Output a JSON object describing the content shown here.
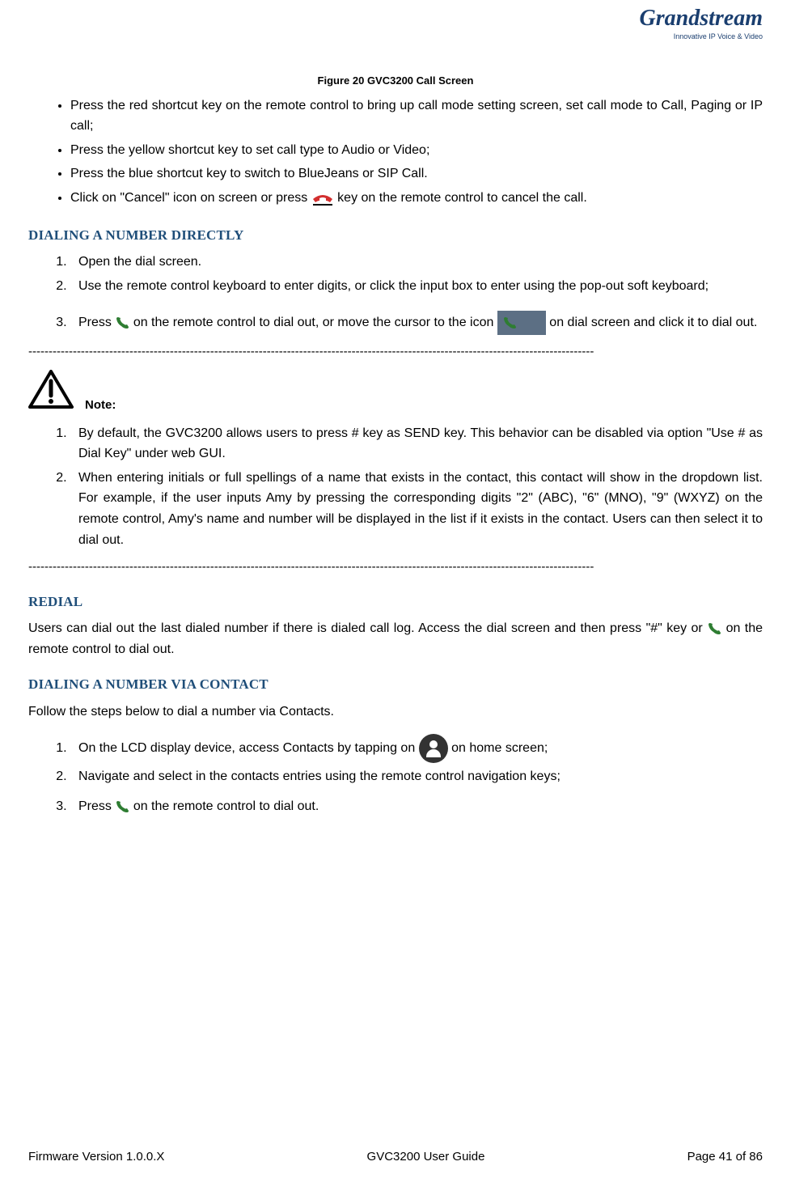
{
  "logo": {
    "brand": "Grandstream",
    "tagline": "Innovative IP Voice & Video"
  },
  "figure_caption": "Figure 20 GVC3200 Call Screen",
  "bullets": [
    "Press the red shortcut key on the remote control to bring up call mode setting screen, set call mode to Call, Paging or IP call;",
    "Press the yellow shortcut key to set call type to Audio or Video;",
    "Press the blue shortcut key to switch to BlueJeans or SIP Call."
  ],
  "bullet4_a": "Click on \"Cancel\" icon on screen or press",
  "bullet4_b": "key on the remote control to cancel the call.",
  "h_dial_direct": "DIALING A NUMBER DIRECTLY",
  "dd_steps": {
    "1": "Open the dial screen.",
    "2": "Use the remote control keyboard to enter digits, or click the input box to enter using the pop-out soft keyboard;"
  },
  "dd_step3_a": "Press",
  "dd_step3_b": "on the remote control to dial out, or move the cursor to the icon",
  "dd_step3_c": "on dial screen and click it to dial out.",
  "divider": "--------------------------------------------------------------------------------------------------------------------------------------------",
  "note_label": "Note:",
  "note_steps": {
    "1": "By default, the GVC3200 allows users to press # key as SEND key. This behavior can be disabled via option \"Use # as Dial Key\" under web GUI.",
    "2": "When entering initials or full spellings of a name that exists in the contact, this contact will show in the dropdown list. For example, if the user inputs Amy by pressing the corresponding digits \"2\" (ABC), \"6\" (MNO), \"9\" (WXYZ) on the remote control, Amy's name and number will be displayed in the list if it exists in the contact. Users can then select it to dial out."
  },
  "h_redial": "REDIAL",
  "redial_a": "Users can dial out the last dialed number if there is dialed call log. Access the dial screen and then press \"#\" key or",
  "redial_b": "on the remote control to dial out.",
  "h_dial_contact": "DIALING A NUMBER VIA CONTACT",
  "dc_intro": "Follow the steps below to dial a number via Contacts.",
  "dc_step1_a": "On the LCD display device, access Contacts by tapping on",
  "dc_step1_b": "on home screen;",
  "dc_step2": "Navigate and select in the contacts entries using the remote control navigation keys;",
  "dc_step3_a": "Press",
  "dc_step3_b": "on the remote control to dial out.",
  "footer": {
    "left": "Firmware Version 1.0.0.X",
    "center": "GVC3200 User Guide",
    "right": "Page 41 of 86"
  }
}
